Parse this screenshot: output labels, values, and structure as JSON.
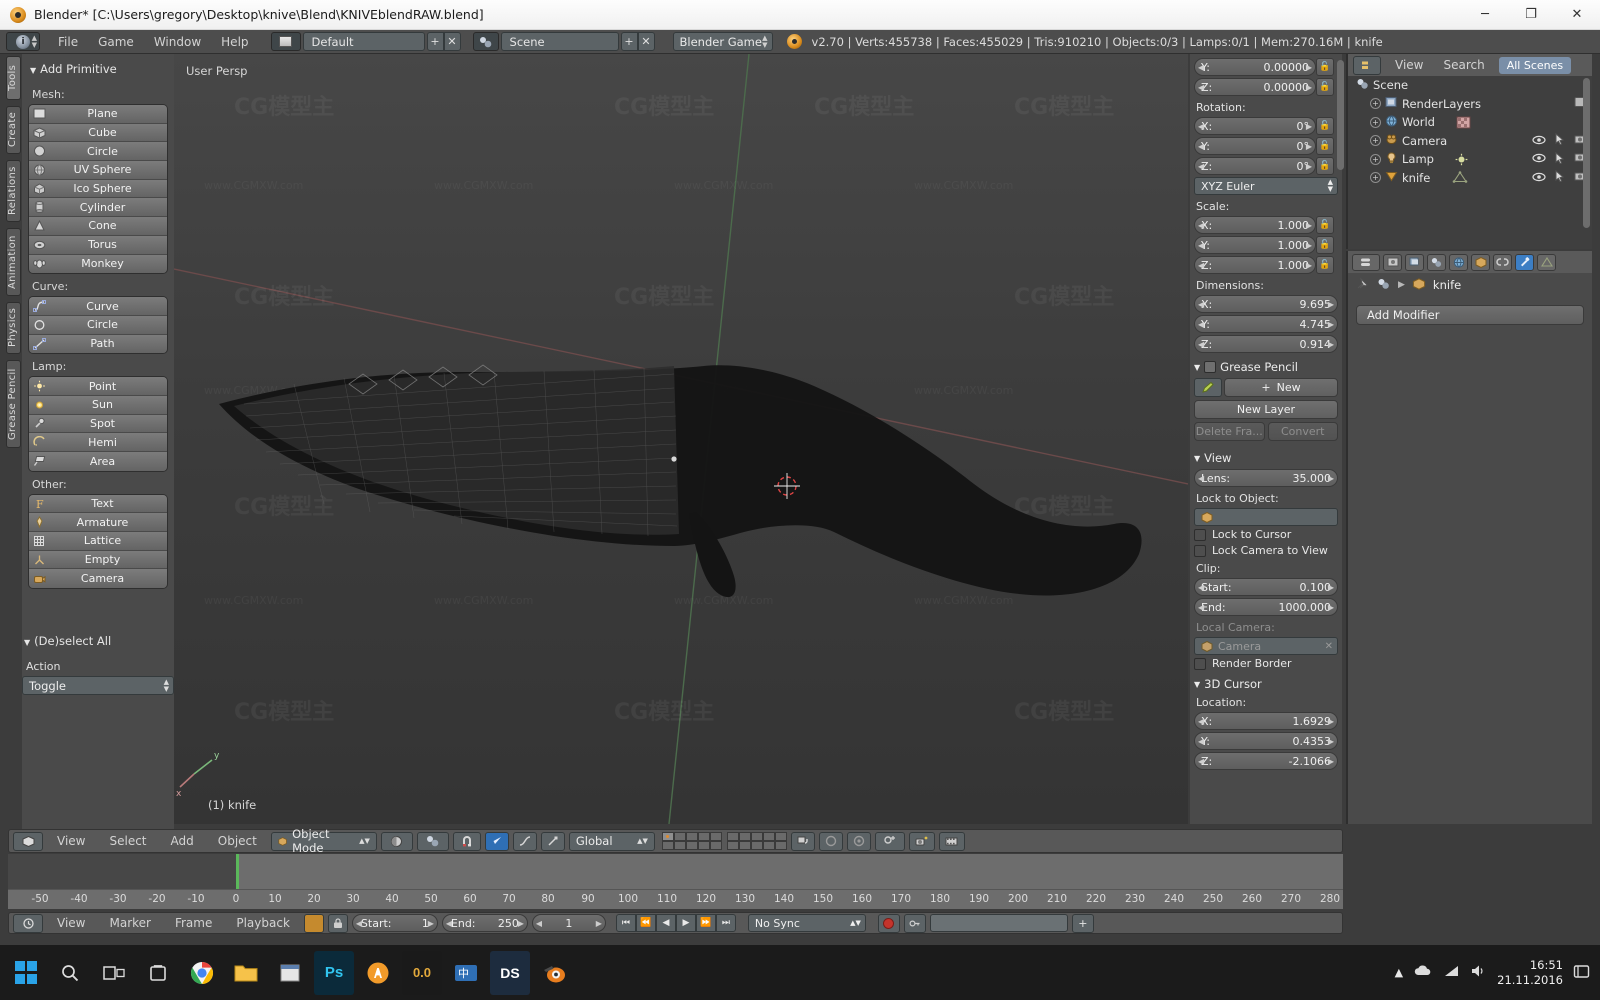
{
  "window": {
    "title": "Blender* [C:\\Users\\gregory\\Desktop\\knive\\Blend\\KNIVEblendRAW.blend]",
    "minimize": "─",
    "maximize": "❐",
    "close": "✕"
  },
  "topbar": {
    "menus": [
      "File",
      "Game",
      "Window",
      "Help"
    ],
    "screen_layout": "Default",
    "scene": "Scene",
    "engine": "Blender Game",
    "plus": "+",
    "x": "✕",
    "info": "v2.70 | Verts:455738 | Faces:455029 | Tris:910210 | Objects:0/3 | Lamps:0/1 | Mem:270.16M | knife",
    "version": "v2.70",
    "verts": "455738",
    "faces": "455029",
    "tris": "910210",
    "objects": "0/3",
    "lamps": "0/1",
    "mem": "270.16M",
    "active_object": "knife"
  },
  "vertical_tabs": [
    "Tools",
    "Create",
    "Relations",
    "Animation",
    "Physics",
    "Grease Pencil"
  ],
  "toolshelf": {
    "panel_title": "Add Primitive",
    "groups": [
      {
        "label": "Mesh:",
        "items": [
          "Plane",
          "Cube",
          "Circle",
          "UV Sphere",
          "Ico Sphere",
          "Cylinder",
          "Cone",
          "Torus",
          "Monkey"
        ]
      },
      {
        "label": "Curve:",
        "items": [
          "Curve",
          "Circle",
          "Path"
        ]
      },
      {
        "label": "Lamp:",
        "items": [
          "Point",
          "Sun",
          "Spot",
          "Hemi",
          "Area"
        ]
      },
      {
        "label": "Other:",
        "items": [
          "Text",
          "Armature",
          "Lattice",
          "Empty",
          "Camera"
        ]
      }
    ],
    "deselect_panel": "(De)select All",
    "action_label": "Action",
    "action_value": "Toggle"
  },
  "viewport": {
    "view_name": "User Persp",
    "object_label": "(1) knife",
    "header": {
      "menus": [
        "View",
        "Select",
        "Add",
        "Object"
      ],
      "mode": "Object Mode",
      "transform_orientation": "Global"
    }
  },
  "npanel": {
    "location_rows": [
      {
        "key": "Y:",
        "value": "0.00000"
      },
      {
        "key": "Z:",
        "value": "0.00000"
      }
    ],
    "rotation_label": "Rotation:",
    "rotation_rows": [
      {
        "key": "X:",
        "value": "0°"
      },
      {
        "key": "Y:",
        "value": "0°"
      },
      {
        "key": "Z:",
        "value": "0°"
      }
    ],
    "rotation_mode": "XYZ Euler",
    "scale_label": "Scale:",
    "scale_rows": [
      {
        "key": "X:",
        "value": "1.000"
      },
      {
        "key": "Y:",
        "value": "1.000"
      },
      {
        "key": "Z:",
        "value": "1.000"
      }
    ],
    "dimensions_label": "Dimensions:",
    "dimension_rows": [
      {
        "key": "X:",
        "value": "9.695"
      },
      {
        "key": "Y:",
        "value": "4.745"
      },
      {
        "key": "Z:",
        "value": "0.914"
      }
    ],
    "grease_pencil": {
      "title": "Grease Pencil",
      "new": "New",
      "new_layer": "New Layer",
      "delete_frame": "Delete Fra...",
      "convert": "Convert"
    },
    "view": {
      "title": "View",
      "lens_key": "Lens:",
      "lens_value": "35.000",
      "lock_to_object_label": "Lock to Object:",
      "lock_to_object_value": "",
      "lock_to_cursor": "Lock to Cursor",
      "lock_camera_to_view": "Lock Camera to View",
      "clip_label": "Clip:",
      "clip_start_key": "Start:",
      "clip_start_value": "0.100",
      "clip_end_key": "End:",
      "clip_end_value": "1000.000",
      "local_camera_label": "Local Camera:",
      "local_camera_value": "Camera",
      "render_border": "Render Border"
    },
    "cursor": {
      "title": "3D Cursor",
      "location_label": "Location:",
      "rows": [
        {
          "key": "X:",
          "value": "1.6929"
        },
        {
          "key": "Y:",
          "value": "0.4353"
        },
        {
          "key": "Z:",
          "value": "-2.1066"
        }
      ]
    }
  },
  "outliner": {
    "menus": [
      "View",
      "Search"
    ],
    "display_mode": "All Scenes",
    "rows": [
      {
        "label": "Scene",
        "depth": 0,
        "icon": "scene-icon",
        "expand": ""
      },
      {
        "label": "RenderLayers",
        "depth": 1,
        "icon": "renderlayers-icon",
        "expand": "+"
      },
      {
        "label": "World",
        "depth": 1,
        "icon": "world-icon",
        "expand": "+"
      },
      {
        "label": "Camera",
        "depth": 1,
        "icon": "camera-icon",
        "expand": "+"
      },
      {
        "label": "Lamp",
        "depth": 1,
        "icon": "lamp-icon",
        "expand": "+"
      },
      {
        "label": "knife",
        "depth": 1,
        "icon": "mesh-icon",
        "expand": "+"
      }
    ]
  },
  "properties": {
    "breadcrumb_object": "knife",
    "add_modifier": "Add Modifier"
  },
  "timeline": {
    "menus": [
      "View",
      "Marker",
      "Frame",
      "Playback"
    ],
    "start_key": "Start:",
    "start_value": "1",
    "end_key": "End:",
    "end_value": "250",
    "current_frame": "1",
    "sync_mode": "No Sync",
    "ticks": [
      "-50",
      "-40",
      "-30",
      "-20",
      "-10",
      "0",
      "10",
      "20",
      "30",
      "40",
      "50",
      "60",
      "70",
      "80",
      "90",
      "100",
      "110",
      "120",
      "130",
      "140",
      "150",
      "160",
      "170",
      "180",
      "190",
      "200",
      "210",
      "220",
      "230",
      "240",
      "250",
      "260",
      "270",
      "280"
    ]
  },
  "taskbar": {
    "time": "16:51",
    "date": "21.11.2016",
    "apps": [
      "start",
      "search",
      "task-view",
      "store",
      "chrome",
      "explorer",
      "calendar",
      "photoshop",
      "illustrator",
      "zbrush",
      "ime",
      "ds",
      "blender"
    ]
  },
  "colors": {
    "accent_blue": "#3c7ec4",
    "playhead_green": "#5bb85b",
    "record_red": "#c4342c",
    "panel_bg": "#4a4a4a",
    "header_bg": "#585858"
  }
}
